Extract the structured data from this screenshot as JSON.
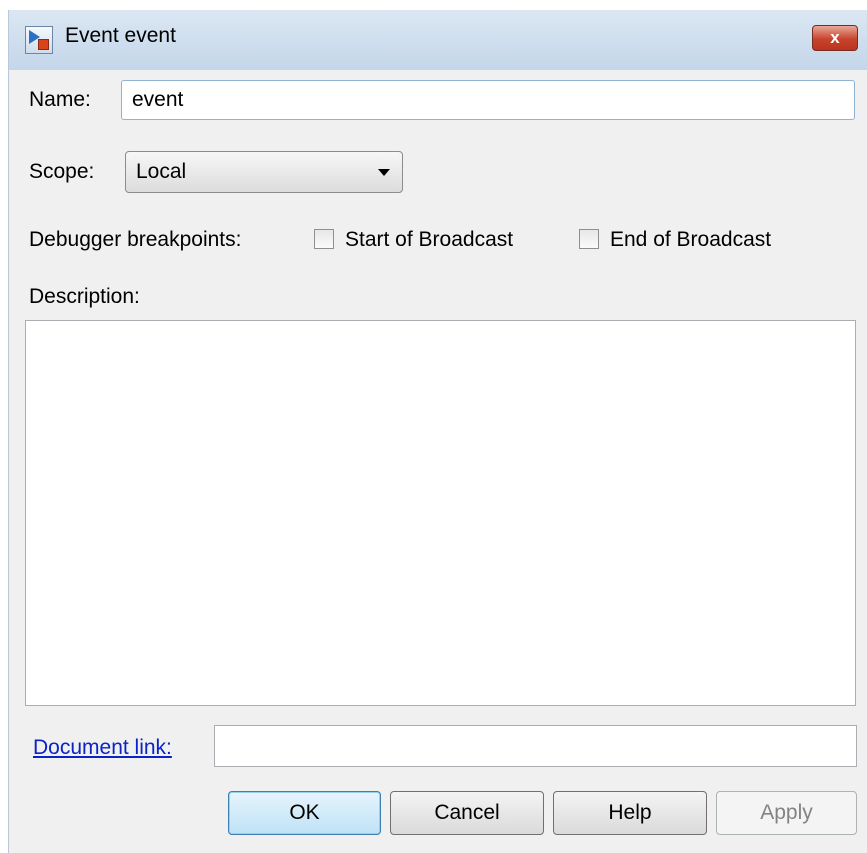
{
  "window": {
    "title": "Event event",
    "close_glyph": "x"
  },
  "form": {
    "name_label": "Name:",
    "name_value": "event",
    "scope_label": "Scope:",
    "scope_value": "Local",
    "debugger_label": "Debugger breakpoints:",
    "breakpoints": [
      {
        "label": "Start of Broadcast",
        "checked": false
      },
      {
        "label": "End of Broadcast",
        "checked": false
      }
    ],
    "description_label": "Description:",
    "description_value": "",
    "document_link_label": "Document link:",
    "document_link_value": ""
  },
  "buttons": {
    "ok": "OK",
    "cancel": "Cancel",
    "help": "Help",
    "apply": "Apply"
  },
  "colors": {
    "link": "#0b22c8",
    "ok_button_border": "#3c7fb1",
    "close_button": "#c7432c"
  }
}
